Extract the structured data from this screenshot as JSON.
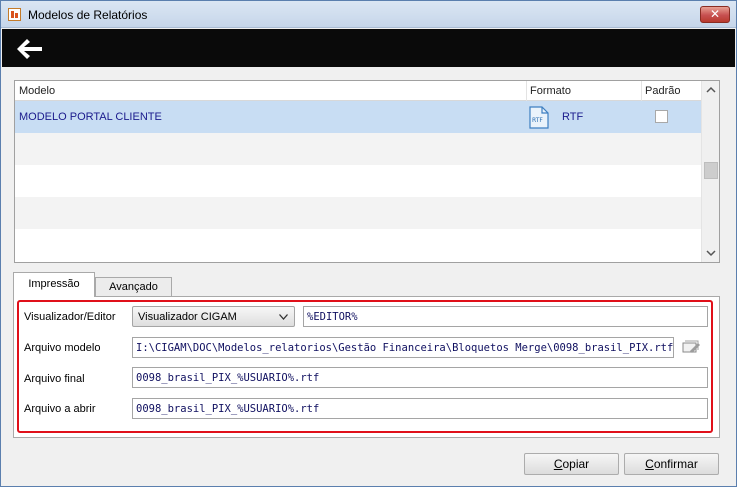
{
  "window": {
    "title": "Modelos de Relatórios",
    "close_label": "✕"
  },
  "toolbar": {
    "back_icon": "arrow-left-icon"
  },
  "grid": {
    "columns": [
      "Modelo",
      "Formato",
      "Padrão"
    ],
    "rows": [
      {
        "modelo": "MODELO PORTAL CLIENTE",
        "formato": "RTF",
        "format_icon_label": "RTF",
        "padrao": false
      }
    ]
  },
  "tabs": [
    "Impressão",
    "Avançado"
  ],
  "form": {
    "visualizador_label": "Visualizador/Editor",
    "visualizador_value": "Visualizador CIGAM",
    "editor_value": "%EDITOR%",
    "arquivo_modelo_label": "Arquivo modelo",
    "arquivo_modelo_value": "I:\\CIGAM\\DOC\\Modelos_relatorios\\Gestão Financeira\\Bloquetos Merge\\0098_brasil_PIX.rtf",
    "arquivo_final_label": "Arquivo final",
    "arquivo_final_value": "0098_brasil_PIX_%USUARIO%.rtf",
    "arquivo_abrir_label": "Arquivo a abrir",
    "arquivo_abrir_value": "0098_brasil_PIX_%USUARIO%.rtf"
  },
  "buttons": {
    "copiar_first": "C",
    "copiar_rest": "opiar",
    "confirmar_first": "C",
    "confirmar_rest": "onfirmar"
  },
  "colors": {
    "highlight": "#e0101a",
    "selection": "#c8ddf3",
    "text_value": "#1a1a8c"
  }
}
